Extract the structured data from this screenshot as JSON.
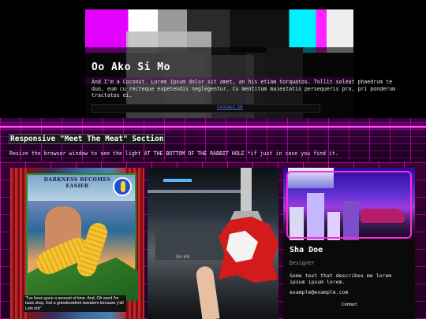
{
  "hero": {
    "title": "Oo Ako Si Mo",
    "text": "And I'm a Coconut. Lorem ipsum dolor sit amet, an his etiam torquatos. Tollit soleat phaedrum te duo, eum cu recteque expetendis neglegentur. Cu mentitum maiestatis persequeris pro, pri ponderum tractatos ei.",
    "link": "Contact Us"
  },
  "section": {
    "title": "Responsive \"Meet The Meat\" Section",
    "subtitle": "Resize the browser window to see the light AT THE BOTTOM OF THE RABBIT HOLE *if just in case you find it."
  },
  "cards": [
    {
      "poster_title": "DARKNESS BECOMES EASIER",
      "quote": "\"I've been gone a amount of time. And, Oh word I'm back okay. Got a grandiosident sweaters because y'all Lets not\""
    },
    {
      "label": "30:00"
    },
    {
      "name": "Sha Doe",
      "role": "Designer",
      "description": "Some text that describes me lorem ipsum ipsum lorem.",
      "email": "example@example.com",
      "contact": "Contact"
    }
  ],
  "colors": {
    "accent": "#ff00ff",
    "grid": "#ff00dc",
    "link": "#5a7dff"
  }
}
